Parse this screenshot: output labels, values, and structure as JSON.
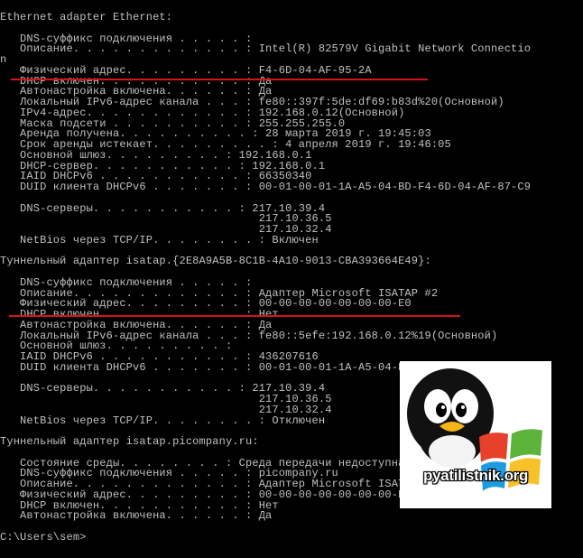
{
  "console_lines": [
    "Ethernet adapter Ethernet:",
    "",
    "   DNS-суффикс подключения . . . . . :",
    "   Описание. . . . . . . . . . . . . : Intel(R) 82579V Gigabit Network Connectio",
    "n",
    "   Физический адрес. . . . . . . . . : F4-6D-04-AF-95-2A",
    "   DHCP включен. . . . . . . . . . . : Да",
    "   Автонастройка включена. . . . . . : Да",
    "   Локальный IPv6-адрес канала . . . : fe80::397f:5de:df69:b83d%20(Основной)",
    "   IPv4-адрес. . . . . . . . . . . . : 192.168.0.12(Основной)",
    "   Маска подсети . . . . . . . . . . : 255.255.255.0",
    "   Аренда получена. . . . . . . . . . : 28 марта 2019 г. 19:45:03",
    "   Срок аренды истекает. . . . . . . . . : 4 апреля 2019 г. 19:46:05",
    "   Основной шлюз. . . . . . . . . : 192.168.0.1",
    "   DHCP-сервер. . . . . . . . . . . : 192.168.0.1",
    "   IAID DHCPv6 . . . . . . . . . . . : 66350340",
    "   DUID клиента DHCPv6 . . . . . . . : 00-01-00-01-1A-A5-04-BD-F4-6D-04-AF-87-C9",
    "",
    "   DNS-серверы. . . . . . . . . . . : 217.10.39.4",
    "                                       217.10.36.5",
    "                                       217.10.32.4",
    "   NetBios через TCP/IP. . . . . . . . : Включен",
    "",
    "Туннельный адаптер isatap.{2E8A9A5B-8C1B-4A10-9013-CBA393664E49}:",
    "",
    "   DNS-суффикс подключения . . . . . :",
    "   Описание. . . . . . . . . . . . . : Адаптер Microsoft ISATAP #2",
    "   Физический адрес. . . . . . . . . : 00-00-00-00-00-00-00-E0",
    "   DHCP включен. . . . . . . . . . . : Нет",
    "   Автонастройка включена. . . . . . : Да",
    "   Локальный IPv6-адрес канала . . . : fe80::5efe:192.168.0.12%19(Основной)",
    "   Основной шлюз. . . . . . . . . :",
    "   IAID DHCPv6 . . . . . . . . . . . : 436207616",
    "   DUID клиента DHCPv6 . . . . . . . : 00-01-00-01-1A-A5-04-BD-F4-6D-04-AF-87-C9",
    "",
    "   DNS-серверы. . . . . . . . . . . : 217.10.39.4",
    "                                       217.10.36.5",
    "                                       217.10.32.4",
    "   NetBios через TCP/IP. . . . . . . . : Отключен",
    "",
    "Туннельный адаптер isatap.picompany.ru:",
    "",
    "   Состояние среды. . . . . . . . : Среда передачи недоступна.",
    "   DNS-суффикс подключения . . . . . : picompany.ru",
    "   Описание. . . . . . . . . . . . . : Адаптер Microsoft ISATAP",
    "   Физический адрес. . . . . . . . . : 00-00-00-00-00-00-00-E0",
    "   DHCP включен. . . . . . . . . . . : Нет",
    "   Автонастройка включена. . . . . . : Да",
    "",
    "C:\\Users\\sem>"
  ],
  "logo": {
    "text": "pyatilistnik.org",
    "icon": "penguin-windows-icon",
    "colors": {
      "red": "#e8412b",
      "green": "#5db43b",
      "blue": "#1e9be0",
      "yellow": "#f7c12a"
    }
  },
  "highlight_color": "#d8141a"
}
